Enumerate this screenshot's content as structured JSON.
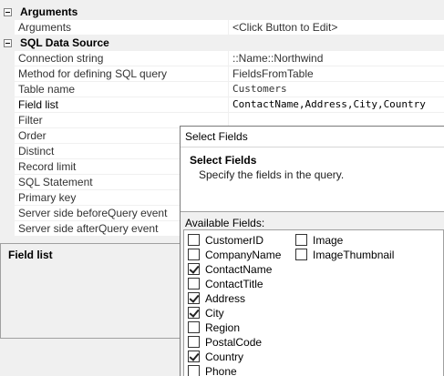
{
  "property_grid": {
    "categories": [
      {
        "label": "Arguments",
        "rows": [
          {
            "name": "Arguments",
            "value": "<Click Button to Edit>"
          }
        ]
      },
      {
        "label": "SQL Data Source",
        "rows": [
          {
            "name": "Connection string",
            "value": "::Name::Northwind"
          },
          {
            "name": "Method for defining SQL query",
            "value": "FieldsFromTable"
          },
          {
            "name": "Table name",
            "value": "Customers"
          },
          {
            "name": "Field list",
            "value": "ContactName,Address,City,Country"
          },
          {
            "name": "Filter",
            "value": ""
          },
          {
            "name": "Order",
            "value": ""
          },
          {
            "name": "Distinct",
            "value": ""
          },
          {
            "name": "Record limit",
            "value": ""
          },
          {
            "name": "SQL Statement",
            "value": ""
          },
          {
            "name": "Primary key",
            "value": ""
          },
          {
            "name": "Server side beforeQuery event",
            "value": ""
          },
          {
            "name": "Server side afterQuery event",
            "value": ""
          }
        ]
      }
    ]
  },
  "description_panel": {
    "title": "Field list"
  },
  "select_fields_dialog": {
    "window_title": "Select Fields",
    "heading": "Select Fields",
    "subheading": "Specify the fields in the query.",
    "available_fields_label": "Available Fields:",
    "fields_column_1": [
      {
        "label": "CustomerID",
        "checked": false
      },
      {
        "label": "CompanyName",
        "checked": false
      },
      {
        "label": "ContactName",
        "checked": true
      },
      {
        "label": "ContactTitle",
        "checked": false
      },
      {
        "label": "Address",
        "checked": true
      },
      {
        "label": "City",
        "checked": true
      },
      {
        "label": "Region",
        "checked": false
      },
      {
        "label": "PostalCode",
        "checked": false
      },
      {
        "label": "Country",
        "checked": true
      },
      {
        "label": "Phone",
        "checked": false
      }
    ],
    "fields_column_2": [
      {
        "label": "Image",
        "checked": false
      },
      {
        "label": "ImageThumbnail",
        "checked": false
      }
    ]
  }
}
